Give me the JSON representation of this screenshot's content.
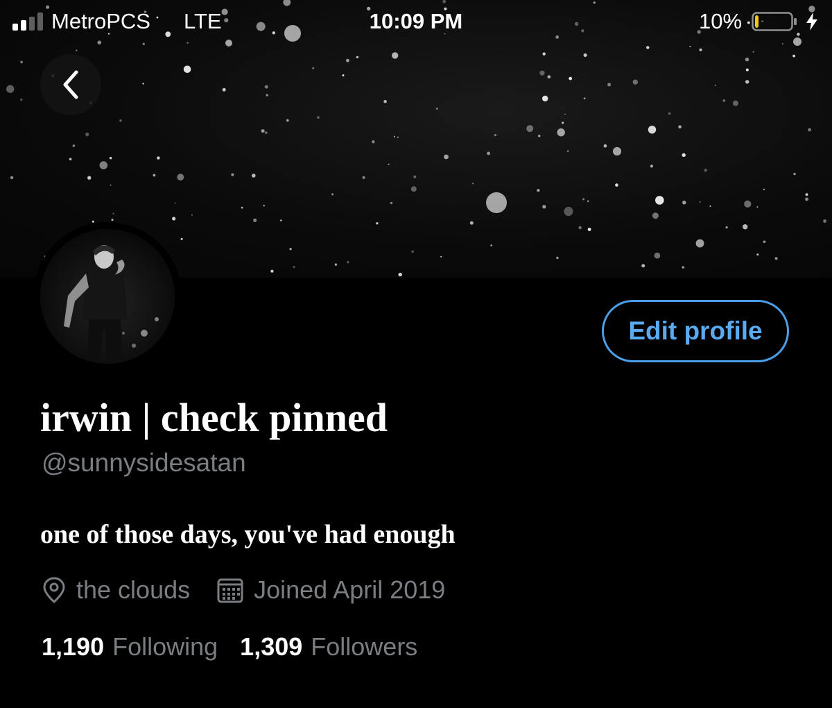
{
  "status_bar": {
    "carrier": "MetroPCS",
    "network": "LTE",
    "time": "10:09 PM",
    "battery_percent": "10%",
    "battery_level": 0.1,
    "battery_color": "#f5c518",
    "signal_bars_active": 2
  },
  "header": {
    "back_icon": "chevron-left-icon",
    "banner_style": "starry night sky, black and white"
  },
  "profile": {
    "display_name": "irwin | check pinned",
    "handle": "@sunnysidesatan",
    "bio": "one of those days, you've had enough",
    "location": "the clouds",
    "location_icon": "location-pin-icon",
    "joined": "Joined April 2019",
    "joined_icon": "calendar-icon",
    "following_count": "1,190",
    "following_label": "Following",
    "followers_count": "1,309",
    "followers_label": "Followers",
    "edit_button_label": "Edit profile"
  },
  "colors": {
    "background": "#000000",
    "accent": "#4a9ee8",
    "secondary_text": "#7a7d82"
  }
}
